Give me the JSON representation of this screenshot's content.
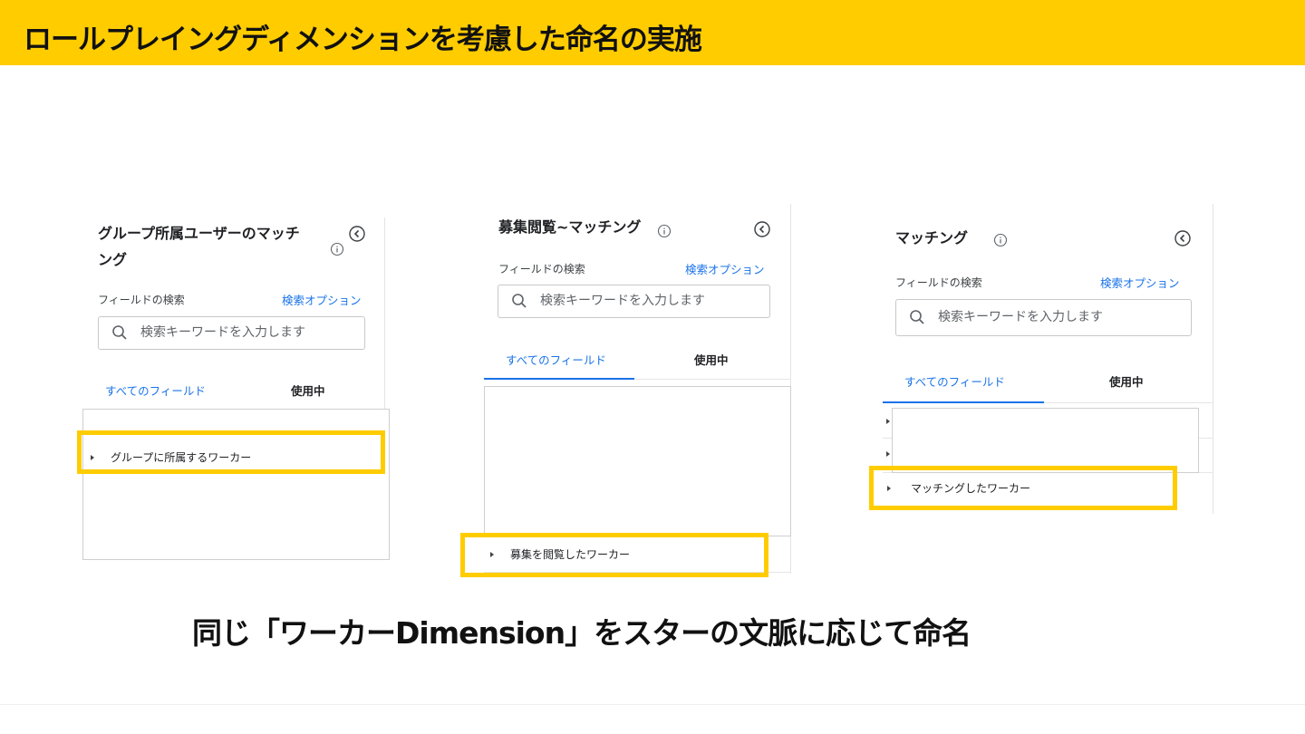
{
  "slide": {
    "title": "ロールプレイングディメンションを考慮した命名の実施",
    "caption": "同じ「ワーカーDimension」をスターの文脈に応じて命名"
  },
  "colors": {
    "accent": "#ffcc00",
    "link": "#1a73e8"
  },
  "panels": [
    {
      "title_line1": "グループ所属ユーザーのマッチ",
      "title_line2": "ング",
      "field_search_label": "フィールドの検索",
      "search_options_label": "検索オプション",
      "search_placeholder": "検索キーワードを入力します",
      "tab_all": "すべてのフィールド",
      "tab_in_use": "使用中",
      "highlighted_item": "グループに所属するワーカー",
      "icons": [
        "info-icon",
        "collapse-left-icon",
        "search-icon",
        "caret-right-icon"
      ]
    },
    {
      "title_line1": "募集閲覧~マッチング",
      "field_search_label": "フィールドの検索",
      "search_options_label": "検索オプション",
      "search_placeholder": "検索キーワードを入力します",
      "tab_all": "すべてのフィールド",
      "tab_in_use": "使用中",
      "highlighted_item": "募集を閲覧したワーカー",
      "icons": [
        "info-icon",
        "collapse-left-icon",
        "search-icon",
        "caret-right-icon"
      ]
    },
    {
      "title_line1": "マッチング",
      "field_search_label": "フィールドの検索",
      "search_options_label": "検索オプション",
      "search_placeholder": "検索キーワードを入力します",
      "tab_all": "すべてのフィールド",
      "tab_in_use": "使用中",
      "highlighted_item": "マッチングしたワーカー",
      "icons": [
        "info-icon",
        "collapse-left-icon",
        "search-icon",
        "caret-right-icon"
      ]
    }
  ]
}
